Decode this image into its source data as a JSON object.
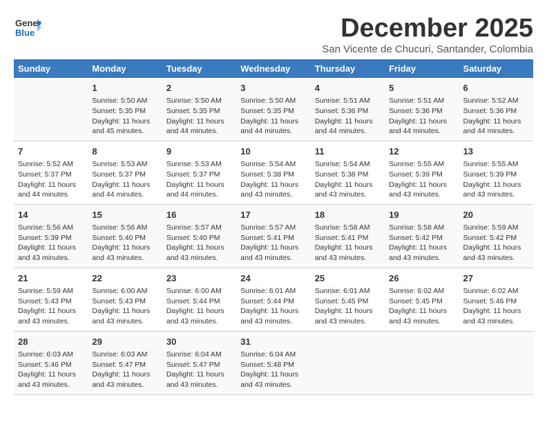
{
  "logo": {
    "line1": "General",
    "line2": "Blue"
  },
  "title": "December 2025",
  "subtitle": "San Vicente de Chucuri, Santander, Colombia",
  "days_of_week": [
    "Sunday",
    "Monday",
    "Tuesday",
    "Wednesday",
    "Thursday",
    "Friday",
    "Saturday"
  ],
  "weeks": [
    [
      {
        "day": "",
        "info": ""
      },
      {
        "day": "1",
        "info": "Sunrise: 5:50 AM\nSunset: 5:35 PM\nDaylight: 11 hours\nand 45 minutes."
      },
      {
        "day": "2",
        "info": "Sunrise: 5:50 AM\nSunset: 5:35 PM\nDaylight: 11 hours\nand 44 minutes."
      },
      {
        "day": "3",
        "info": "Sunrise: 5:50 AM\nSunset: 5:35 PM\nDaylight: 11 hours\nand 44 minutes."
      },
      {
        "day": "4",
        "info": "Sunrise: 5:51 AM\nSunset: 5:36 PM\nDaylight: 11 hours\nand 44 minutes."
      },
      {
        "day": "5",
        "info": "Sunrise: 5:51 AM\nSunset: 5:36 PM\nDaylight: 11 hours\nand 44 minutes."
      },
      {
        "day": "6",
        "info": "Sunrise: 5:52 AM\nSunset: 5:36 PM\nDaylight: 11 hours\nand 44 minutes."
      }
    ],
    [
      {
        "day": "7",
        "info": "Sunrise: 5:52 AM\nSunset: 5:37 PM\nDaylight: 11 hours\nand 44 minutes."
      },
      {
        "day": "8",
        "info": "Sunrise: 5:53 AM\nSunset: 5:37 PM\nDaylight: 11 hours\nand 44 minutes."
      },
      {
        "day": "9",
        "info": "Sunrise: 5:53 AM\nSunset: 5:37 PM\nDaylight: 11 hours\nand 44 minutes."
      },
      {
        "day": "10",
        "info": "Sunrise: 5:54 AM\nSunset: 5:38 PM\nDaylight: 11 hours\nand 43 minutes."
      },
      {
        "day": "11",
        "info": "Sunrise: 5:54 AM\nSunset: 5:38 PM\nDaylight: 11 hours\nand 43 minutes."
      },
      {
        "day": "12",
        "info": "Sunrise: 5:55 AM\nSunset: 5:39 PM\nDaylight: 11 hours\nand 43 minutes."
      },
      {
        "day": "13",
        "info": "Sunrise: 5:55 AM\nSunset: 5:39 PM\nDaylight: 11 hours\nand 43 minutes."
      }
    ],
    [
      {
        "day": "14",
        "info": "Sunrise: 5:56 AM\nSunset: 5:39 PM\nDaylight: 11 hours\nand 43 minutes."
      },
      {
        "day": "15",
        "info": "Sunrise: 5:56 AM\nSunset: 5:40 PM\nDaylight: 11 hours\nand 43 minutes."
      },
      {
        "day": "16",
        "info": "Sunrise: 5:57 AM\nSunset: 5:40 PM\nDaylight: 11 hours\nand 43 minutes."
      },
      {
        "day": "17",
        "info": "Sunrise: 5:57 AM\nSunset: 5:41 PM\nDaylight: 11 hours\nand 43 minutes."
      },
      {
        "day": "18",
        "info": "Sunrise: 5:58 AM\nSunset: 5:41 PM\nDaylight: 11 hours\nand 43 minutes."
      },
      {
        "day": "19",
        "info": "Sunrise: 5:58 AM\nSunset: 5:42 PM\nDaylight: 11 hours\nand 43 minutes."
      },
      {
        "day": "20",
        "info": "Sunrise: 5:59 AM\nSunset: 5:42 PM\nDaylight: 11 hours\nand 43 minutes."
      }
    ],
    [
      {
        "day": "21",
        "info": "Sunrise: 5:59 AM\nSunset: 5:43 PM\nDaylight: 11 hours\nand 43 minutes."
      },
      {
        "day": "22",
        "info": "Sunrise: 6:00 AM\nSunset: 5:43 PM\nDaylight: 11 hours\nand 43 minutes."
      },
      {
        "day": "23",
        "info": "Sunrise: 6:00 AM\nSunset: 5:44 PM\nDaylight: 11 hours\nand 43 minutes."
      },
      {
        "day": "24",
        "info": "Sunrise: 6:01 AM\nSunset: 5:44 PM\nDaylight: 11 hours\nand 43 minutes."
      },
      {
        "day": "25",
        "info": "Sunrise: 6:01 AM\nSunset: 5:45 PM\nDaylight: 11 hours\nand 43 minutes."
      },
      {
        "day": "26",
        "info": "Sunrise: 6:02 AM\nSunset: 5:45 PM\nDaylight: 11 hours\nand 43 minutes."
      },
      {
        "day": "27",
        "info": "Sunrise: 6:02 AM\nSunset: 5:46 PM\nDaylight: 11 hours\nand 43 minutes."
      }
    ],
    [
      {
        "day": "28",
        "info": "Sunrise: 6:03 AM\nSunset: 5:46 PM\nDaylight: 11 hours\nand 43 minutes."
      },
      {
        "day": "29",
        "info": "Sunrise: 6:03 AM\nSunset: 5:47 PM\nDaylight: 11 hours\nand 43 minutes."
      },
      {
        "day": "30",
        "info": "Sunrise: 6:04 AM\nSunset: 5:47 PM\nDaylight: 11 hours\nand 43 minutes."
      },
      {
        "day": "31",
        "info": "Sunrise: 6:04 AM\nSunset: 5:48 PM\nDaylight: 11 hours\nand 43 minutes."
      },
      {
        "day": "",
        "info": ""
      },
      {
        "day": "",
        "info": ""
      },
      {
        "day": "",
        "info": ""
      }
    ]
  ]
}
